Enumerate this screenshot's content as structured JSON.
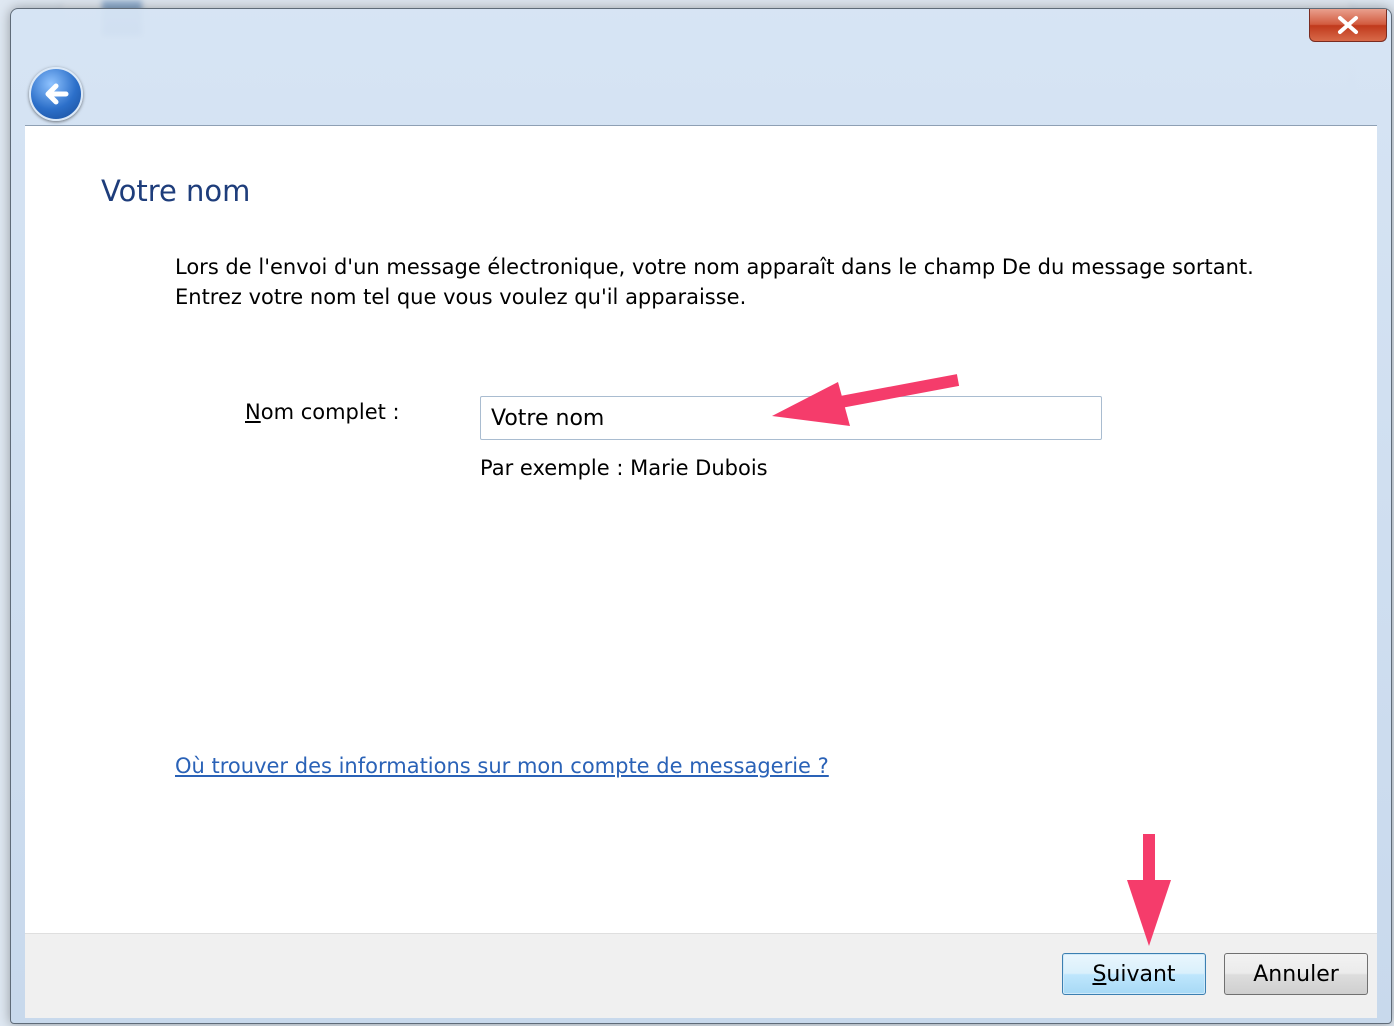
{
  "dialog": {
    "page_title": "Votre nom",
    "description_line1": "Lors de l'envoi d'un message électronique, votre nom apparaît dans le champ De du message sortant.",
    "description_line2": "Entrez votre nom tel que vous voulez qu'il apparaisse.",
    "name_label_accel": "N",
    "name_label_rest": "om complet :",
    "name_value": "Votre nom",
    "example_text": "Par exemple : Marie Dubois",
    "help_link": "Où trouver des informations sur mon compte de messagerie ?",
    "buttons": {
      "next_accel": "S",
      "next_rest": "uivant",
      "cancel": "Annuler"
    }
  },
  "colors": {
    "title": "#1e3d7b",
    "link": "#2a62b7",
    "annotation_arrow": "#f53c6b"
  },
  "icons": [
    "back-arrow-icon",
    "close-icon"
  ]
}
